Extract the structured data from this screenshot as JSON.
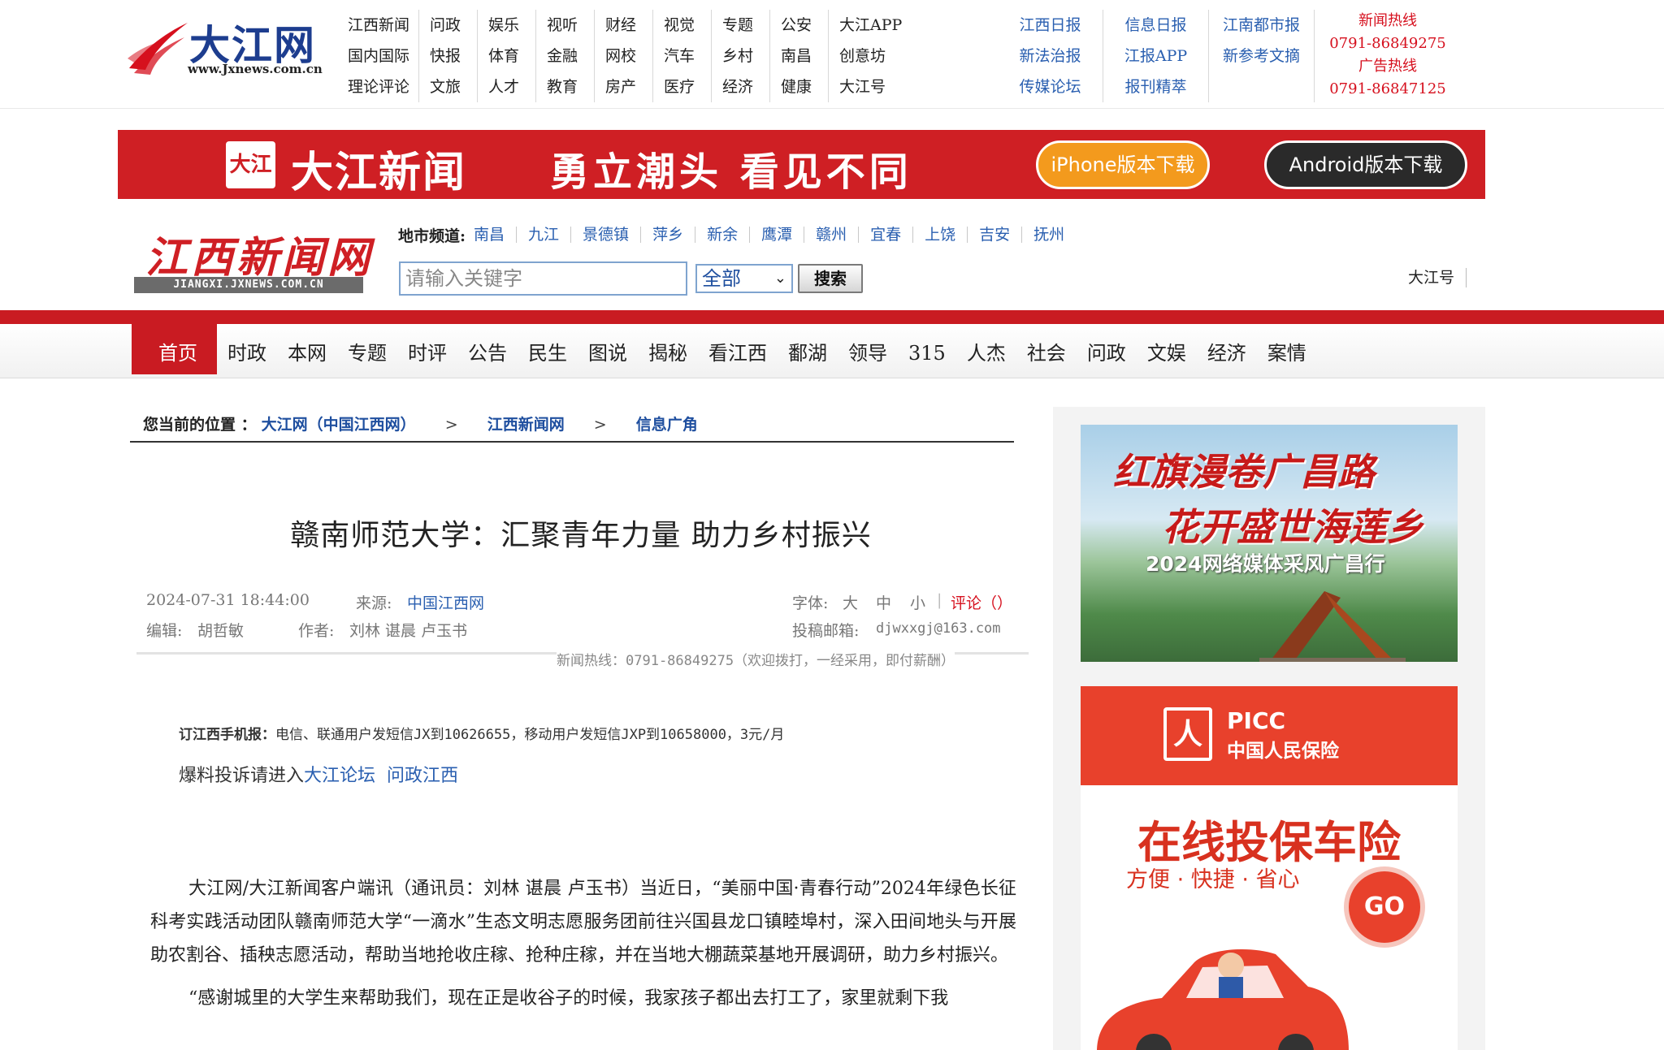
{
  "header": {
    "logo_text": "大江网",
    "logo_url_text": "www.Jxnews.com.cn",
    "channels": [
      [
        "江西新闻",
        "问政",
        "娱乐",
        "视听",
        "财经",
        "视觉",
        "专题",
        "公安",
        "大江APP"
      ],
      [
        "国内国际",
        "快报",
        "体育",
        "金融",
        "网校",
        "汽车",
        "乡村",
        "南昌",
        "创意坊"
      ],
      [
        "理论评论",
        "文旅",
        "人才",
        "教育",
        "房产",
        "医疗",
        "经济",
        "健康",
        "大江号"
      ]
    ],
    "papers": [
      [
        "江西日报",
        "信息日报",
        "江南都市报"
      ],
      [
        "新法治报",
        "江报APP",
        "新参考文摘"
      ],
      [
        "传媒论坛",
        "报刊精萃",
        ""
      ]
    ],
    "hotline": {
      "news_label": "新闻热线",
      "news_number": "0791-86849275",
      "ad_label": "广告热线",
      "ad_number": "0791-86847125"
    }
  },
  "banner": {
    "logo_badge": "大江",
    "brand": "大江新闻",
    "slogan": "勇立潮头 看见不同",
    "ios_button": "iPhone版本下载",
    "android_button": "Android版本下载"
  },
  "jx_logo": {
    "text": "江西新闻网",
    "url_text": "JIANGXI.JXNEWS.COM.CN"
  },
  "city_channels": {
    "label": "地市频道:",
    "cities": [
      "南昌",
      "九江",
      "景德镇",
      "萍乡",
      "新余",
      "鹰潭",
      "赣州",
      "宜春",
      "上饶",
      "吉安",
      "抚州"
    ]
  },
  "search": {
    "placeholder": "请输入关键字",
    "scope": "全部",
    "button": "搜索"
  },
  "dajianghao_link": "大江号",
  "nav": {
    "items": [
      "首页",
      "时政",
      "本网",
      "专题",
      "时评",
      "公告",
      "民生",
      "图说",
      "揭秘",
      "看江西",
      "鄱湖",
      "领导",
      "315",
      "人杰",
      "社会",
      "问政",
      "文娱",
      "经济",
      "案情"
    ]
  },
  "breadcrumb": {
    "label": "您当前的位置 ：",
    "items": [
      "大江网（中国江西网）",
      "江西新闻网",
      "信息广角"
    ],
    "separator": ">"
  },
  "article": {
    "title": "赣南师范大学：汇聚青年力量 助力乡村振兴",
    "datetime": "2024-07-31 18:44:00",
    "source_label": "来源:",
    "source": "中国江西网",
    "font_label": "字体:",
    "font_large": "大",
    "font_medium": "中",
    "font_small": "小",
    "comment": "评论（）",
    "editor_label": "编辑:",
    "editor": "胡哲敏",
    "author_label": "作者:",
    "author": "刘林 谌晨 卢玉书",
    "email_label": "投稿邮箱:",
    "email": "djwxxgj@163.com",
    "hotline_note": "新闻热线：0791-86849275（欢迎拨打，一经采用，即付薪酬）",
    "subscribe_label": "订江西手机报：",
    "subscribe_text": "电信、联通用户发短信JX到10626655，移动用户发短信JXP到10658000，3元/月",
    "complaint_prefix": "爆料投诉请进入",
    "complaint_link1": "大江论坛",
    "complaint_link2": "问政江西",
    "paragraphs": [
      "大江网/大江新闻客户端讯（通讯员：刘林 谌晨 卢玉书）当近日，“美丽中国·青春行动”2024年绿色长征科考实践活动团队赣南师范大学“一滴水”生态文明志愿服务团前往兴国县龙口镇睦埠村，深入田间地头与开展助农割谷、插秧志愿活动，帮助当地抢收庄稼、抢种庄稼，并在当地大棚蔬菜基地开展调研，助力乡村振兴。",
      "“感谢城里的大学生来帮助我们，现在正是收谷子的时候，我家孩子都出去打工了，家里就剩下我"
    ]
  },
  "sidebar": {
    "ad_travel": {
      "line1": "红旗漫卷广昌路",
      "line2": "花开盛世海莲乡",
      "line3": "2024网络媒体采风广昌行"
    },
    "ad_picc": {
      "badge": "人",
      "en": "PICC",
      "cn": "中国人民保险",
      "headline": "在线投保车险",
      "sub": "方便 · 快捷 · 省心",
      "go": "GO"
    }
  },
  "colors": {
    "brand_red": "#c91b22",
    "link_blue": "#2a5fb0",
    "hotline_red": "#d6101e"
  }
}
